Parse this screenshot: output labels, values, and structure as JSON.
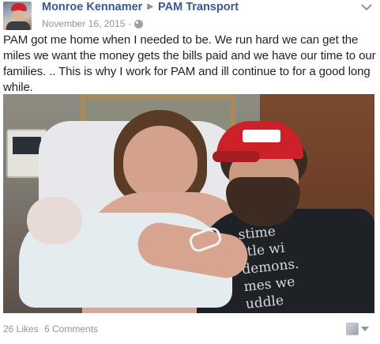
{
  "header": {
    "author": "Monroe Kennamer",
    "target_page": "PAM Transport",
    "date": "November 16, 2015",
    "separator": "·",
    "privacy_icon": "globe-icon",
    "options_icon": "chevron-down-icon"
  },
  "post": {
    "text": "PAM got me home when I needed to be. We run hard we can get the miles we want the money gets the bills paid and we have our time to our families. .. This is why I work for PAM and ill continue to for a good long while."
  },
  "photo": {
    "shirt_text": "stime\nstle wi\ndemons.\nmes we\nuddle"
  },
  "footer": {
    "likes": "26 Likes",
    "comments": "6 Comments",
    "actor_icon": "page-icon",
    "caret_icon": "caret-down-icon"
  },
  "colors": {
    "link": "#365899",
    "meta": "#90949c",
    "text": "#1d2129"
  }
}
